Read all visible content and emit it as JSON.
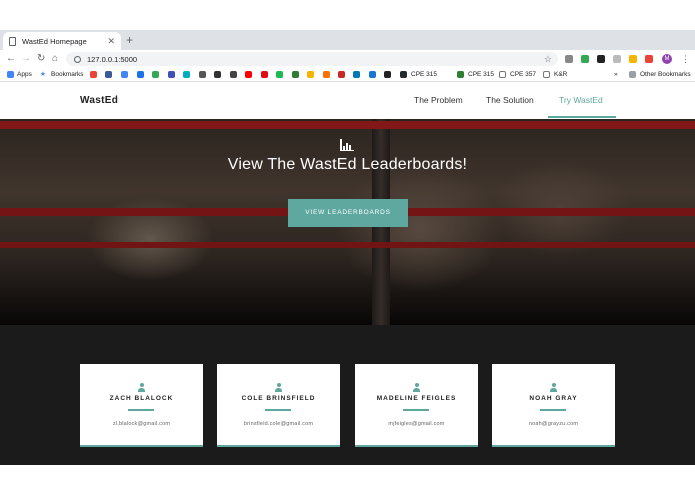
{
  "browser": {
    "tab_title": "WastEd Homepage",
    "url": "127.0.0.1:5000",
    "avatar_letter": "M",
    "bookmarks": {
      "apps": "Apps",
      "bookmarks": "Bookmarks",
      "cpe1": "CPE 315",
      "cpe2": "CPE 315",
      "cpe3": "CPE 357",
      "kr": "K&R",
      "more": "»",
      "other": "Other Bookmarks"
    }
  },
  "site": {
    "brand": "WastEd",
    "nav": {
      "problem": "The Problem",
      "solution": "The Solution",
      "try": "Try WastEd"
    },
    "hero": {
      "title": "View The WastEd Leaderboards!",
      "button": "VIEW LEADERBOARDS"
    },
    "team": [
      {
        "name": "ZACH BLALOCK",
        "email": "zl.blalock@gmail.com"
      },
      {
        "name": "COLE BRINSFIELD",
        "email": "brinsfield.cole@gmail.com"
      },
      {
        "name": "MADELINE FEIGLES",
        "email": "mjfeigles@gmail.com"
      },
      {
        "name": "NOAH GRAY",
        "email": "noah@grayzu.com"
      }
    ]
  },
  "colors": {
    "accent": "#5fa8a0",
    "dark_section": "#1b1b1b",
    "rope": "#b52121"
  }
}
